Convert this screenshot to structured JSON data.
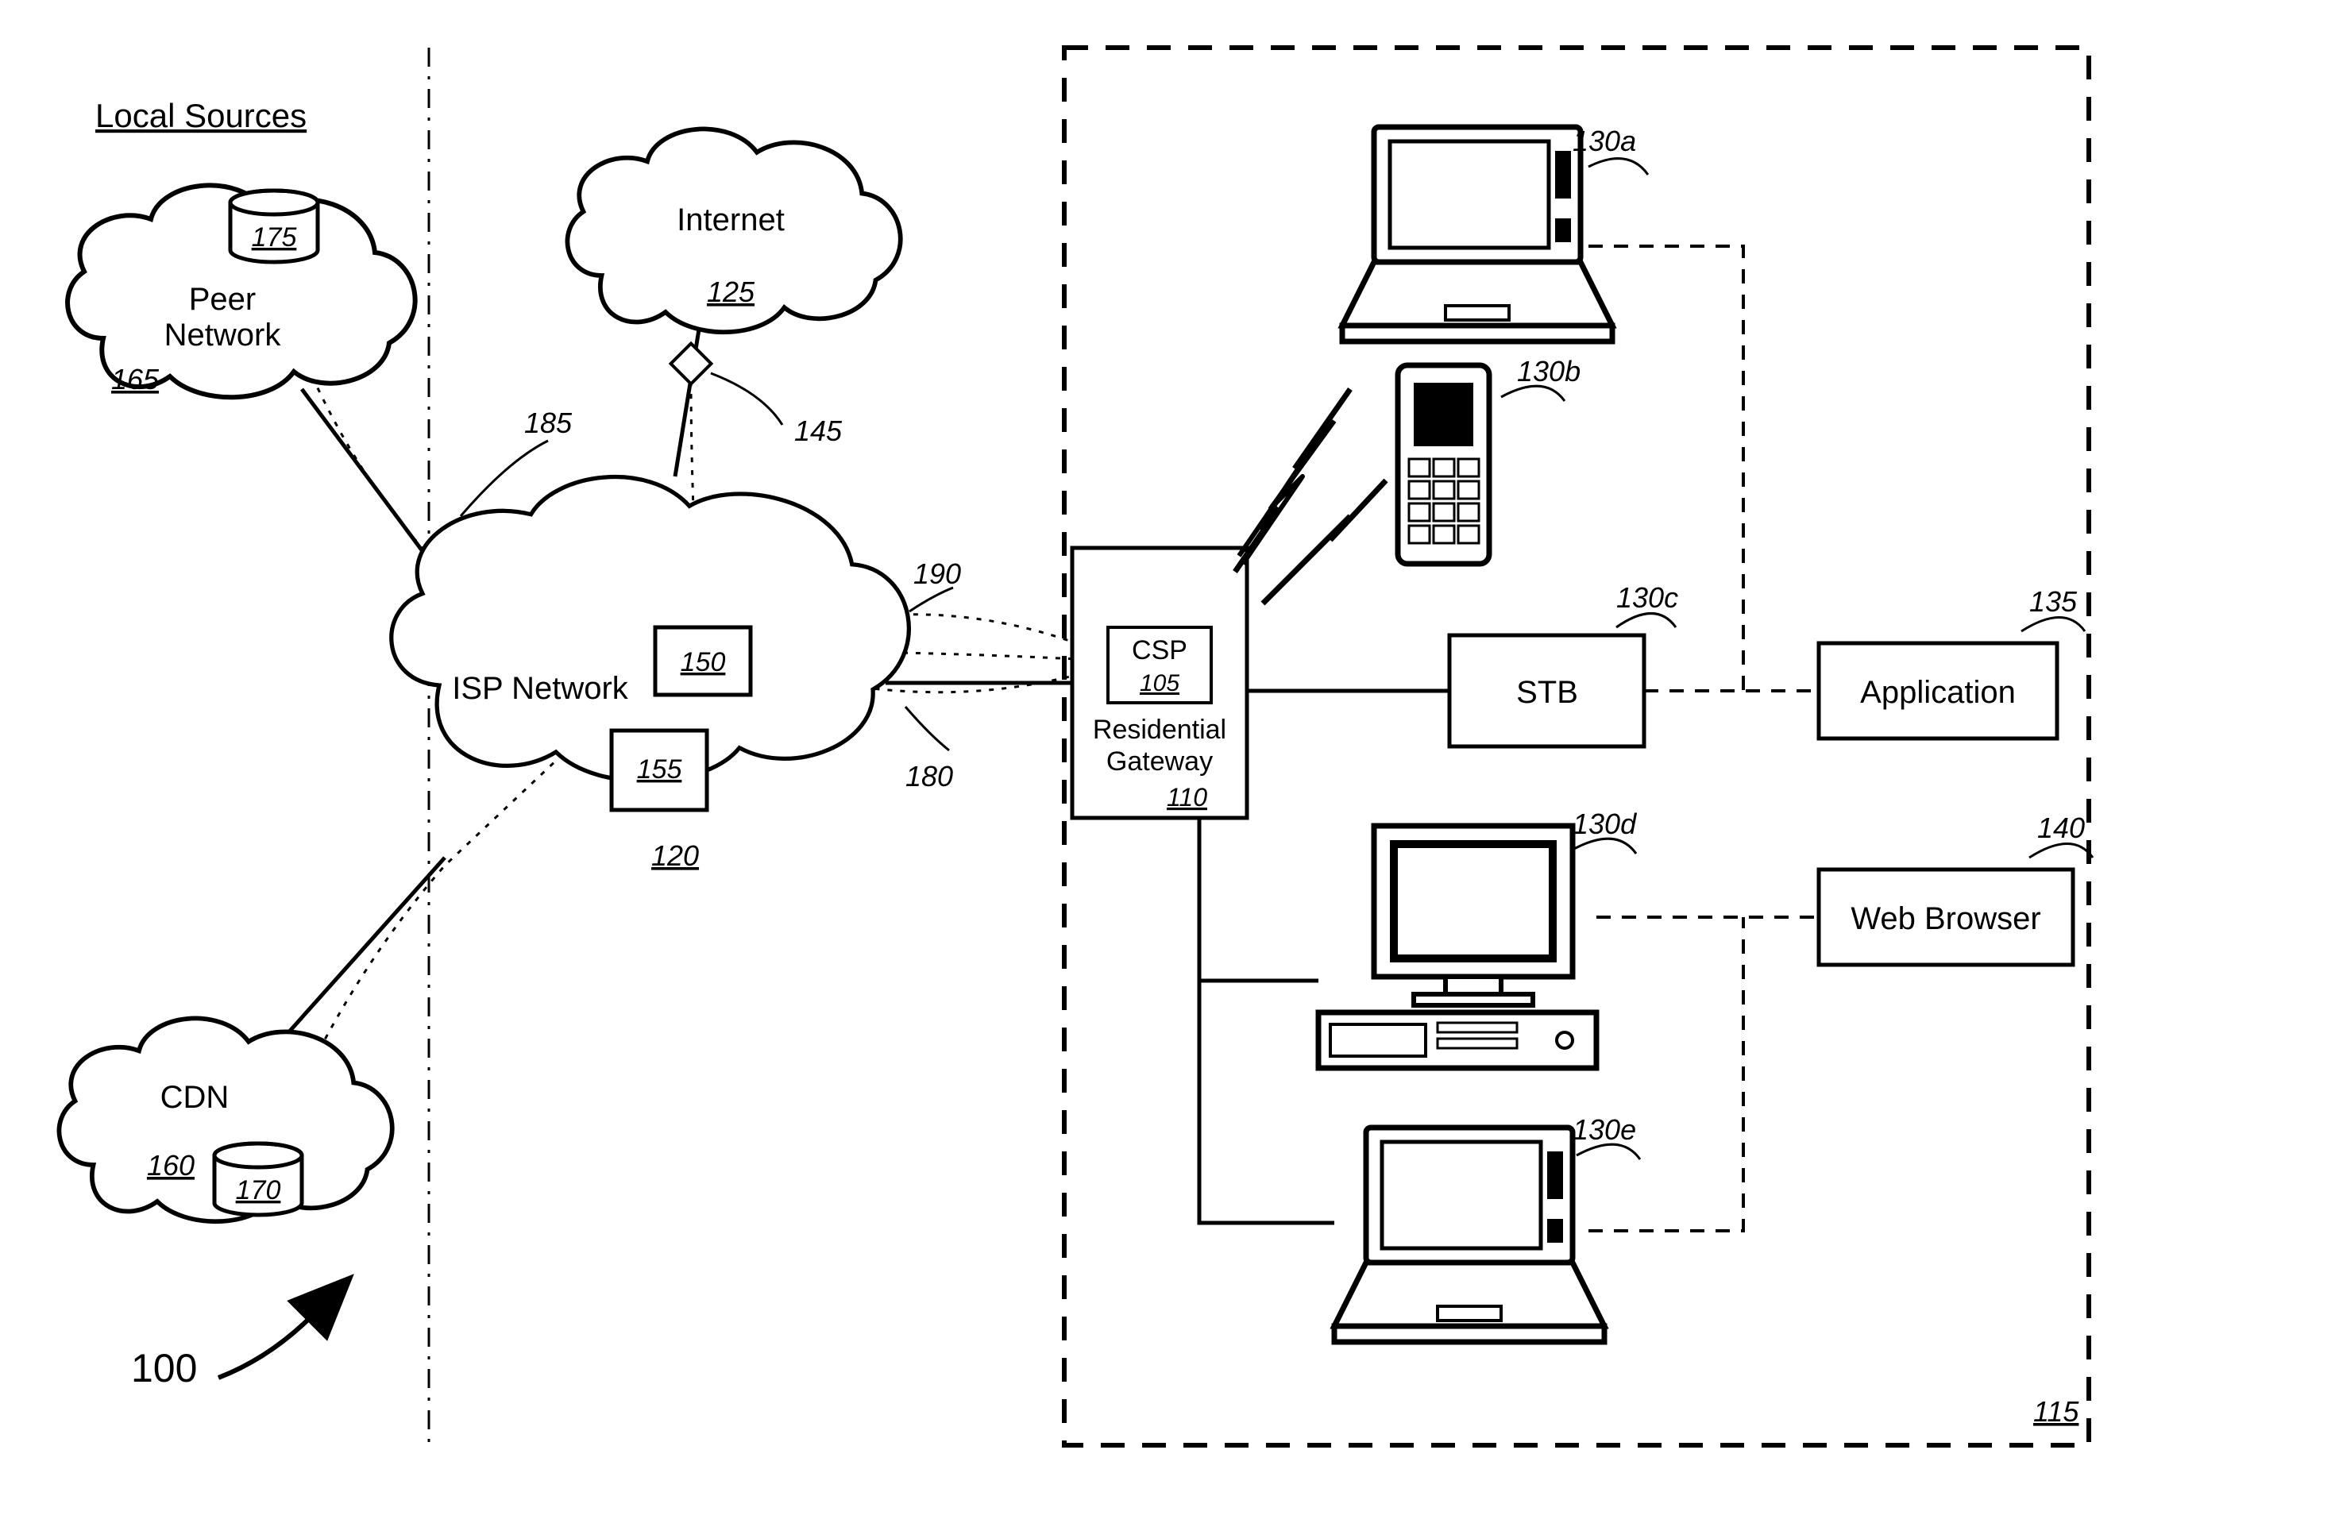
{
  "title": "Local Sources",
  "figure_number": "100",
  "clouds": {
    "internet": {
      "label": "Internet",
      "ref": "125"
    },
    "isp": {
      "label": "ISP Network",
      "ref": "120"
    },
    "peer": {
      "line1": "Peer",
      "line2": "Network",
      "ref": "165"
    },
    "cdn": {
      "label": "CDN",
      "ref": "160"
    }
  },
  "storage": {
    "peer_db": {
      "ref": "175"
    },
    "cdn_db": {
      "ref": "170"
    }
  },
  "isp_internal": {
    "box150": "150",
    "box155": "155"
  },
  "lead_refs": {
    "peering_point": "145",
    "arc185": "185",
    "arc190": "190",
    "arc180": "180"
  },
  "gateway": {
    "csp_label": "CSP",
    "csp_ref": "105",
    "line1": "Residential",
    "line2": "Gateway",
    "ref": "110"
  },
  "house_ref": "115",
  "devices": {
    "laptop_a": "130a",
    "phone": "130b",
    "stb_label": "STB",
    "stb_ref": "130c",
    "desktop": "130d",
    "laptop_e": "130e"
  },
  "apps": {
    "application": {
      "label": "Application",
      "ref": "135"
    },
    "browser": {
      "label": "Web Browser",
      "ref": "140"
    }
  }
}
